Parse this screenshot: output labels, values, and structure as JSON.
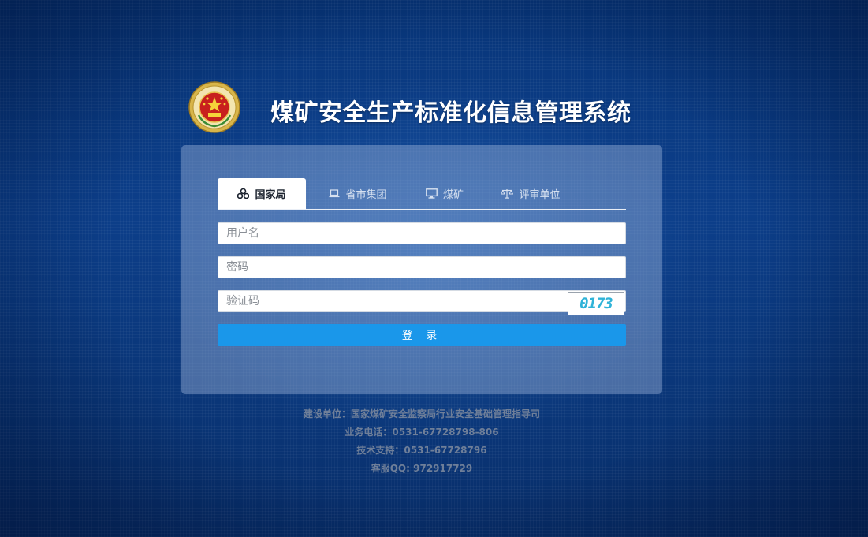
{
  "header": {
    "title": "煤矿安全生产标准化信息管理系统",
    "emblem_icon": "national-emblem-icon"
  },
  "login": {
    "tabs": [
      {
        "label": "国家局",
        "icon": "sitemap-icon",
        "active": true
      },
      {
        "label": "省市集团",
        "icon": "laptop-icon",
        "active": false
      },
      {
        "label": "煤矿",
        "icon": "monitor-icon",
        "active": false
      },
      {
        "label": "评审单位",
        "icon": "scales-icon",
        "active": false
      }
    ],
    "username_placeholder": "用户名",
    "password_placeholder": "密码",
    "captcha_placeholder": "验证码",
    "captcha_code": "0173",
    "submit_label": "登 录"
  },
  "footer": {
    "builder": "建设单位：国家煤矿安全监察局行业安全基础管理指导司",
    "business_phone": "业务电话：0531-67728798-806",
    "tech_support": "技术支持：0531-67728796",
    "service_qq": "客服QQ: 972917729"
  },
  "colors": {
    "background": "#0a3c86",
    "button": "#1a97ea",
    "footer_text": "#6f7f99"
  }
}
